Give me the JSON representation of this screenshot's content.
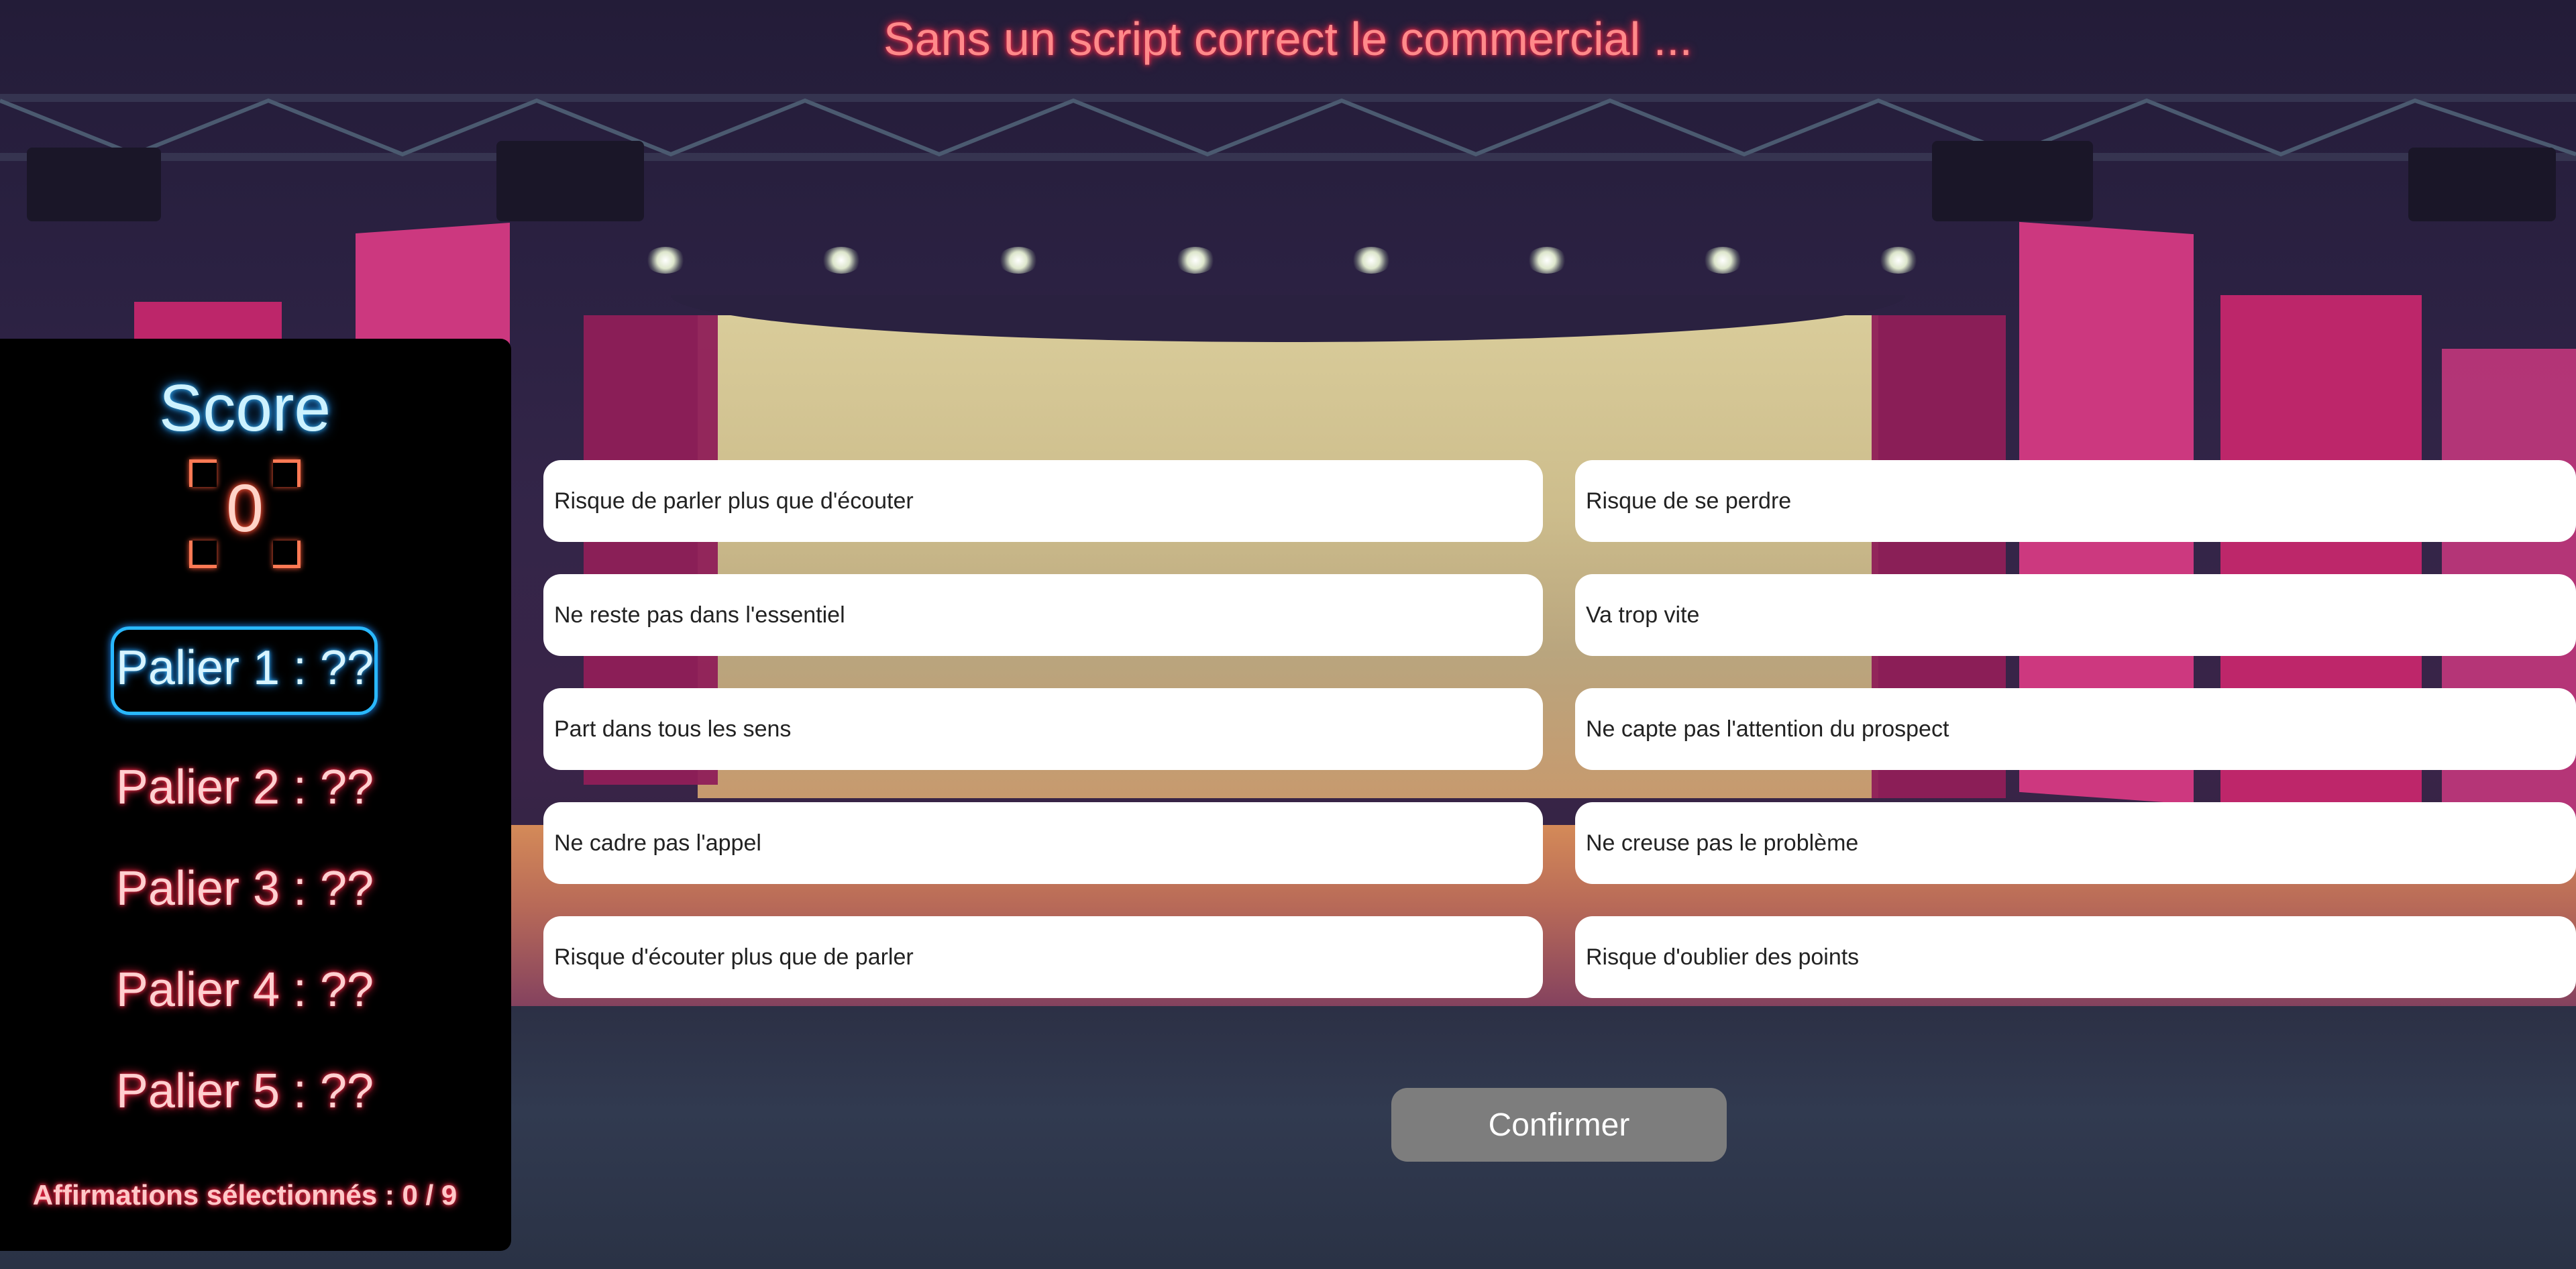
{
  "title": "Sans un script correct le commercial ...",
  "score": {
    "label": "Score",
    "value": "0"
  },
  "paliers": [
    {
      "label": "Palier 1 : ??",
      "active": true
    },
    {
      "label": "Palier 2 : ??",
      "active": false
    },
    {
      "label": "Palier 3 : ??",
      "active": false
    },
    {
      "label": "Palier 4 : ??",
      "active": false
    },
    {
      "label": "Palier 5 : ??",
      "active": false
    }
  ],
  "counter": "Affirmations sélectionnés : 0 / 9",
  "answers": [
    "Risque de parler plus que d'écouter",
    "Risque de se perdre",
    "Ne reste pas dans l'essentiel",
    "Va trop vite",
    "Part dans tous les sens",
    "Ne capte pas l'attention du prospect",
    "Ne cadre pas l'appel",
    "Ne creuse pas le problème",
    "Risque d'écouter plus que de parler",
    "Risque d'oublier des points"
  ],
  "confirm_label": "Confirmer",
  "colors": {
    "neon_red": "#ff2a4a",
    "neon_blue": "#29b8ff",
    "confirm_bg": "#7d7d7d"
  }
}
